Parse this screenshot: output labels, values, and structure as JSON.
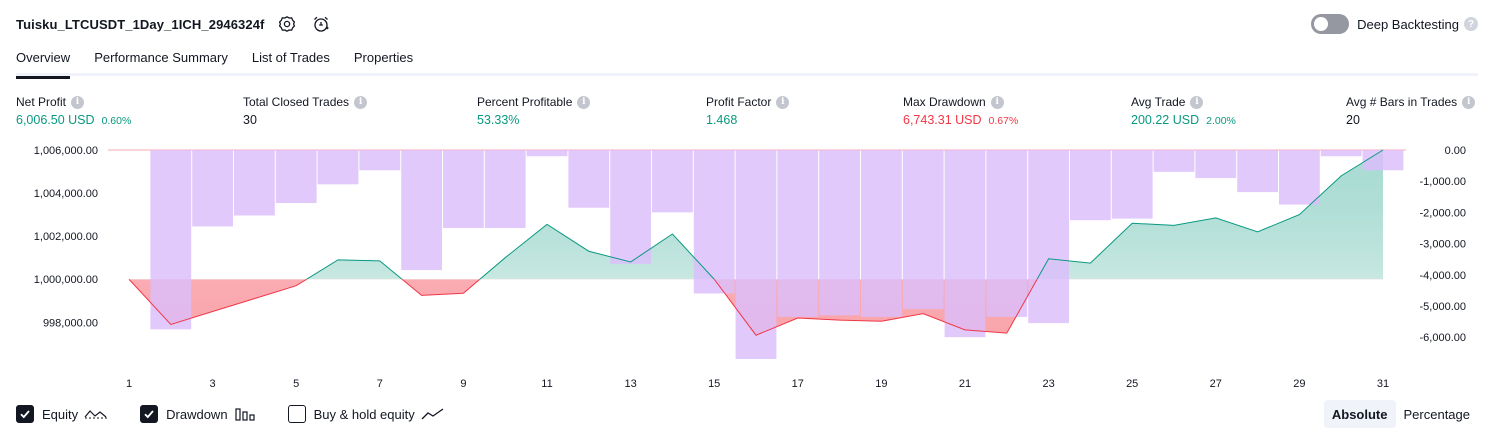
{
  "header": {
    "title": "Tuisku_LTCUSDT_1Day_1ICH_2946324f",
    "deep_backtesting_label": "Deep Backtesting",
    "help_glyph": "?"
  },
  "tabs": [
    {
      "label": "Overview",
      "active": true
    },
    {
      "label": "Performance Summary",
      "active": false
    },
    {
      "label": "List of Trades",
      "active": false
    },
    {
      "label": "Properties",
      "active": false
    }
  ],
  "metrics": {
    "info_glyph": "i",
    "net_profit": {
      "label": "Net Profit",
      "value": "6,006.50 USD",
      "pct": "0.60%"
    },
    "total_closed_trades": {
      "label": "Total Closed Trades",
      "value": "30"
    },
    "percent_profitable": {
      "label": "Percent Profitable",
      "value": "53.33%"
    },
    "profit_factor": {
      "label": "Profit Factor",
      "value": "1.468"
    },
    "max_drawdown": {
      "label": "Max Drawdown",
      "value": "6,743.31 USD",
      "pct": "0.67%"
    },
    "avg_trade": {
      "label": "Avg Trade",
      "value": "200.22 USD",
      "pct": "2.00%"
    },
    "avg_bars": {
      "label": "Avg # Bars in Trades",
      "value": "20"
    }
  },
  "colors": {
    "green": "#089981",
    "red": "#f23645",
    "drawdown_bar": "#dcbdfb",
    "equity_fill_green": "#d4ede5",
    "equity_fill_red": "#fcc8cc"
  },
  "chart_data": {
    "type": "line",
    "x": [
      1,
      2,
      3,
      4,
      5,
      6,
      7,
      8,
      9,
      10,
      11,
      12,
      13,
      14,
      15,
      16,
      17,
      18,
      19,
      20,
      21,
      22,
      23,
      24,
      25,
      26,
      27,
      28,
      29,
      30,
      31
    ],
    "x_tick_labels": [
      "1",
      "3",
      "5",
      "7",
      "9",
      "11",
      "13",
      "15",
      "17",
      "19",
      "21",
      "23",
      "25",
      "27",
      "29",
      "31"
    ],
    "series": [
      {
        "name": "Equity",
        "axis": "left",
        "values": [
          1000000,
          997900,
          998500,
          999100,
          999700,
          1000900,
          1000850,
          999250,
          999350,
          1001000,
          1002550,
          1001300,
          1000800,
          1002100,
          1000000,
          997400,
          998200,
          998100,
          998050,
          998400,
          997650,
          997500,
          1000950,
          1000750,
          1002600,
          1002500,
          1002850,
          1002200,
          1003000,
          1004800,
          1006000
        ]
      },
      {
        "name": "Drawdown",
        "axis": "right",
        "type": "bar",
        "values": [
          null,
          -5750,
          -2450,
          -2100,
          -1700,
          -1100,
          -650,
          -3850,
          -2500,
          -2500,
          -200,
          -1850,
          -3650,
          -2000,
          -4600,
          -6700,
          -5350,
          -5300,
          -5350,
          -5100,
          -6000,
          -5350,
          -5550,
          -2250,
          -2200,
          -700,
          -900,
          -1350,
          -1750,
          -200,
          -650
        ]
      }
    ],
    "left_axis": {
      "ylim": [
        996900,
        1006000
      ],
      "ticks": [
        "1,006,000.00",
        "1,004,000.00",
        "1,002,000.00",
        "1,000,000.00",
        "998,000.00"
      ],
      "tick_values": [
        1006000,
        1004000,
        1002000,
        1000000,
        998000
      ]
    },
    "right_axis": {
      "ylim": [
        -6700,
        0
      ],
      "ticks": [
        "0.00",
        "-1,000.00",
        "-2,000.00",
        "-3,000.00",
        "-4,000.00",
        "-5,000.00",
        "-6,000.00"
      ],
      "tick_values": [
        0,
        -1000,
        -2000,
        -3000,
        -4000,
        -5000,
        -6000
      ]
    },
    "baseline": 1000000
  },
  "legend": {
    "equity": {
      "label": "Equity",
      "checked": true
    },
    "drawdown": {
      "label": "Drawdown",
      "checked": true
    },
    "buy_hold": {
      "label": "Buy & hold equity",
      "checked": false
    }
  },
  "scale_toggle": {
    "absolute": "Absolute",
    "percentage": "Percentage",
    "selected": "Absolute"
  }
}
